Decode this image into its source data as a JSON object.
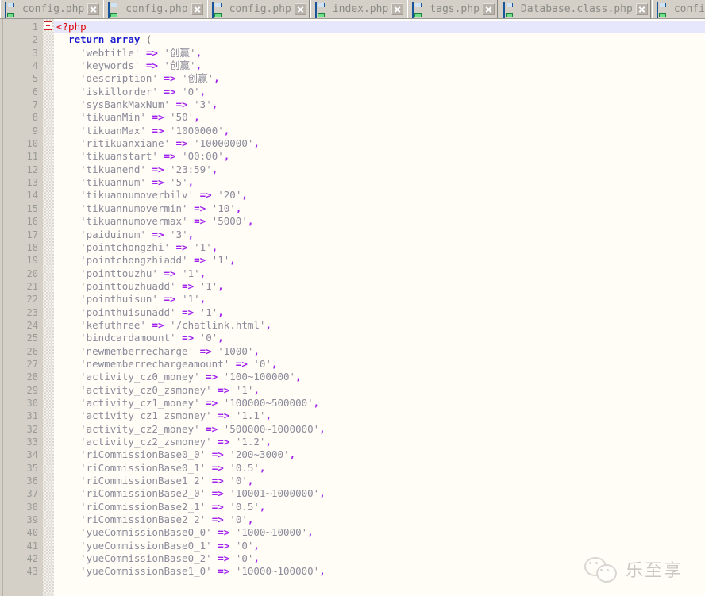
{
  "window": {
    "app": "php-source-editor",
    "document_language": "PHP"
  },
  "tabbar": {
    "tabs": [
      {
        "label": "config.php",
        "icon": "floppy-disk-icon",
        "close_icon": "close-icon"
      },
      {
        "label": "config.php",
        "icon": "floppy-disk-icon",
        "close_icon": "close-icon"
      },
      {
        "label": "config.php",
        "icon": "floppy-disk-icon",
        "close_icon": "close-icon"
      },
      {
        "label": "index.php",
        "icon": "floppy-disk-icon",
        "close_icon": "close-icon"
      },
      {
        "label": "tags.php",
        "icon": "floppy-disk-icon",
        "close_icon": "close-icon"
      },
      {
        "label": "Database.class.php",
        "icon": "floppy-disk-icon",
        "close_icon": "close-icon"
      },
      {
        "label": "config",
        "icon": "floppy-disk-icon",
        "close_icon": "close-icon"
      }
    ]
  },
  "gutter": {
    "line_numbers": [
      1,
      2,
      3,
      4,
      5,
      6,
      7,
      8,
      9,
      10,
      11,
      12,
      13,
      14,
      15,
      16,
      17,
      18,
      19,
      20,
      21,
      22,
      23,
      24,
      25,
      26,
      27,
      28,
      29,
      30,
      31,
      32,
      33,
      34,
      35,
      36,
      37,
      38,
      39,
      40,
      41,
      42,
      43
    ],
    "fold_marker": "collapse-minus-icon"
  },
  "editor": {
    "current_line": 1,
    "colors": {
      "background": "#fffdf5",
      "current_line_background": "#e6e6fc",
      "gutter_background": "#d4d0c8",
      "line_number": "#9b9b96",
      "php_tag": "#e00000",
      "keyword": "#1a1ad0",
      "string": "#8a8a9a",
      "operator": "#a020f0",
      "punctuation": "#808080",
      "fold_line": "#cc2222"
    },
    "lines": [
      {
        "n": 1,
        "type": "tag",
        "text": "<?php"
      },
      {
        "n": 2,
        "type": "kw",
        "indent": 1,
        "keyword": "return array",
        "punct": "("
      },
      {
        "n": 3,
        "type": "pair",
        "indent": 2,
        "key": "webtitle",
        "value": "创赢",
        "cjk": true
      },
      {
        "n": 4,
        "type": "pair",
        "indent": 2,
        "key": "keywords",
        "value": "创赢",
        "cjk": true
      },
      {
        "n": 5,
        "type": "pair",
        "indent": 2,
        "key": "description",
        "value": "创赢",
        "cjk": true
      },
      {
        "n": 6,
        "type": "pair",
        "indent": 2,
        "key": "iskillorder",
        "value": "0"
      },
      {
        "n": 7,
        "type": "pair",
        "indent": 2,
        "key": "sysBankMaxNum",
        "value": "3"
      },
      {
        "n": 8,
        "type": "pair",
        "indent": 2,
        "key": "tikuanMin",
        "value": "50"
      },
      {
        "n": 9,
        "type": "pair",
        "indent": 2,
        "key": "tikuanMax",
        "value": "1000000"
      },
      {
        "n": 10,
        "type": "pair",
        "indent": 2,
        "key": "ritikuanxiane",
        "value": "10000000"
      },
      {
        "n": 11,
        "type": "pair",
        "indent": 2,
        "key": "tikuanstart",
        "value": "00:00"
      },
      {
        "n": 12,
        "type": "pair",
        "indent": 2,
        "key": "tikuanend",
        "value": "23:59"
      },
      {
        "n": 13,
        "type": "pair",
        "indent": 2,
        "key": "tikuannum",
        "value": "5"
      },
      {
        "n": 14,
        "type": "pair",
        "indent": 2,
        "key": "tikuannumoverbilv",
        "value": "20"
      },
      {
        "n": 15,
        "type": "pair",
        "indent": 2,
        "key": "tikuannumovermin",
        "value": "10"
      },
      {
        "n": 16,
        "type": "pair",
        "indent": 2,
        "key": "tikuannumovermax",
        "value": "5000"
      },
      {
        "n": 17,
        "type": "pair",
        "indent": 2,
        "key": "paiduinum",
        "value": "3"
      },
      {
        "n": 18,
        "type": "pair",
        "indent": 2,
        "key": "pointchongzhi",
        "value": "1"
      },
      {
        "n": 19,
        "type": "pair",
        "indent": 2,
        "key": "pointchongzhiadd",
        "value": "1"
      },
      {
        "n": 20,
        "type": "pair",
        "indent": 2,
        "key": "pointtouzhu",
        "value": "1"
      },
      {
        "n": 21,
        "type": "pair",
        "indent": 2,
        "key": "pointtouzhuadd",
        "value": "1"
      },
      {
        "n": 22,
        "type": "pair",
        "indent": 2,
        "key": "pointhuisun",
        "value": "1"
      },
      {
        "n": 23,
        "type": "pair",
        "indent": 2,
        "key": "pointhuisunadd",
        "value": "1"
      },
      {
        "n": 24,
        "type": "pair",
        "indent": 2,
        "key": "kefuthree",
        "value": "/chatlink.html"
      },
      {
        "n": 25,
        "type": "pair",
        "indent": 2,
        "key": "bindcardamount",
        "value": "0"
      },
      {
        "n": 26,
        "type": "pair",
        "indent": 2,
        "key": "newmemberrecharge",
        "value": "1000"
      },
      {
        "n": 27,
        "type": "pair",
        "indent": 2,
        "key": "newmemberrechargeamount",
        "value": "0"
      },
      {
        "n": 28,
        "type": "pair",
        "indent": 2,
        "key": "activity_cz0_money",
        "value": "100~100000"
      },
      {
        "n": 29,
        "type": "pair",
        "indent": 2,
        "key": "activity_cz0_zsmoney",
        "value": "1"
      },
      {
        "n": 30,
        "type": "pair",
        "indent": 2,
        "key": "activity_cz1_money",
        "value": "100000~500000"
      },
      {
        "n": 31,
        "type": "pair",
        "indent": 2,
        "key": "activity_cz1_zsmoney",
        "value": "1.1"
      },
      {
        "n": 32,
        "type": "pair",
        "indent": 2,
        "key": "activity_cz2_money",
        "value": "500000~1000000"
      },
      {
        "n": 33,
        "type": "pair",
        "indent": 2,
        "key": "activity_cz2_zsmoney",
        "value": "1.2"
      },
      {
        "n": 34,
        "type": "pair",
        "indent": 2,
        "key": "riCommissionBase0_0",
        "value": "200~3000"
      },
      {
        "n": 35,
        "type": "pair",
        "indent": 2,
        "key": "riCommissionBase0_1",
        "value": "0.5"
      },
      {
        "n": 36,
        "type": "pair",
        "indent": 2,
        "key": "riCommissionBase1_2",
        "value": "0"
      },
      {
        "n": 37,
        "type": "pair",
        "indent": 2,
        "key": "riCommissionBase2_0",
        "value": "10001~1000000"
      },
      {
        "n": 38,
        "type": "pair",
        "indent": 2,
        "key": "riCommissionBase2_1",
        "value": "0.5"
      },
      {
        "n": 39,
        "type": "pair",
        "indent": 2,
        "key": "riCommissionBase2_2",
        "value": "0"
      },
      {
        "n": 40,
        "type": "pair",
        "indent": 2,
        "key": "yueCommissionBase0_0",
        "value": "1000~10000"
      },
      {
        "n": 41,
        "type": "pair",
        "indent": 2,
        "key": "yueCommissionBase0_1",
        "value": "0"
      },
      {
        "n": 42,
        "type": "pair",
        "indent": 2,
        "key": "yueCommissionBase0_2",
        "value": "0"
      },
      {
        "n": 43,
        "type": "pair",
        "indent": 2,
        "key": "yueCommissionBase1_0",
        "value": "10000~100000"
      }
    ]
  },
  "watermark": {
    "text": "乐至享",
    "icon": "wechat-logo-icon",
    "color": "#9c9c9c"
  }
}
